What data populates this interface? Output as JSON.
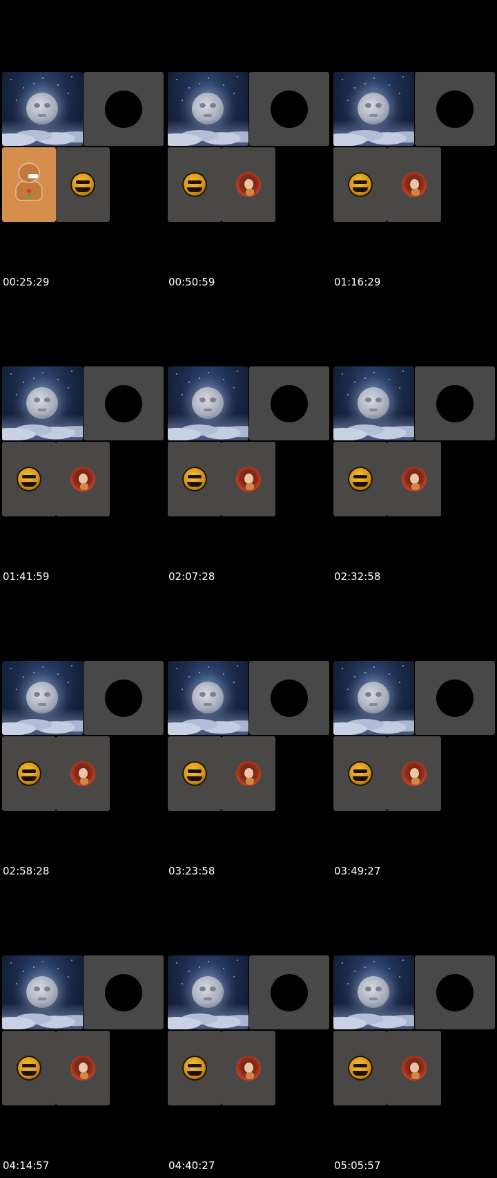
{
  "thumbnails": [
    {
      "timestamp": "00:25:29",
      "first_avatar": "gingerbread",
      "second_avatar": "pumpkin"
    },
    {
      "timestamp": "00:50:59",
      "first_avatar": "pumpkin",
      "second_avatar": "redhair"
    },
    {
      "timestamp": "01:16:29",
      "first_avatar": "pumpkin",
      "second_avatar": "redhair"
    },
    {
      "timestamp": "01:41:59",
      "first_avatar": "pumpkin",
      "second_avatar": "redhair"
    },
    {
      "timestamp": "02:07:28",
      "first_avatar": "pumpkin",
      "second_avatar": "redhair"
    },
    {
      "timestamp": "02:32:58",
      "first_avatar": "pumpkin",
      "second_avatar": "redhair"
    },
    {
      "timestamp": "02:58:28",
      "first_avatar": "pumpkin",
      "second_avatar": "redhair"
    },
    {
      "timestamp": "03:23:58",
      "first_avatar": "pumpkin",
      "second_avatar": "redhair"
    },
    {
      "timestamp": "03:49:27",
      "first_avatar": "pumpkin",
      "second_avatar": "redhair"
    },
    {
      "timestamp": "04:14:57",
      "first_avatar": "pumpkin",
      "second_avatar": "redhair"
    },
    {
      "timestamp": "04:40:27",
      "first_avatar": "pumpkin",
      "second_avatar": "redhair"
    },
    {
      "timestamp": "05:05:57",
      "first_avatar": "pumpkin",
      "second_avatar": "redhair"
    }
  ],
  "icons": {
    "moon": "moon-cloud-icon",
    "ring": "black-circle-icon",
    "pumpkin": "pumpkin-avatar-icon",
    "redhair": "redhair-avatar-icon",
    "gingerbread": "gingerbread-avatar-icon"
  },
  "colors": {
    "background": "#000000",
    "tile": "#4a4747",
    "ring_tile": "#484848",
    "ginger_tile": "#d58e4b",
    "timestamp": "#ffffff"
  }
}
